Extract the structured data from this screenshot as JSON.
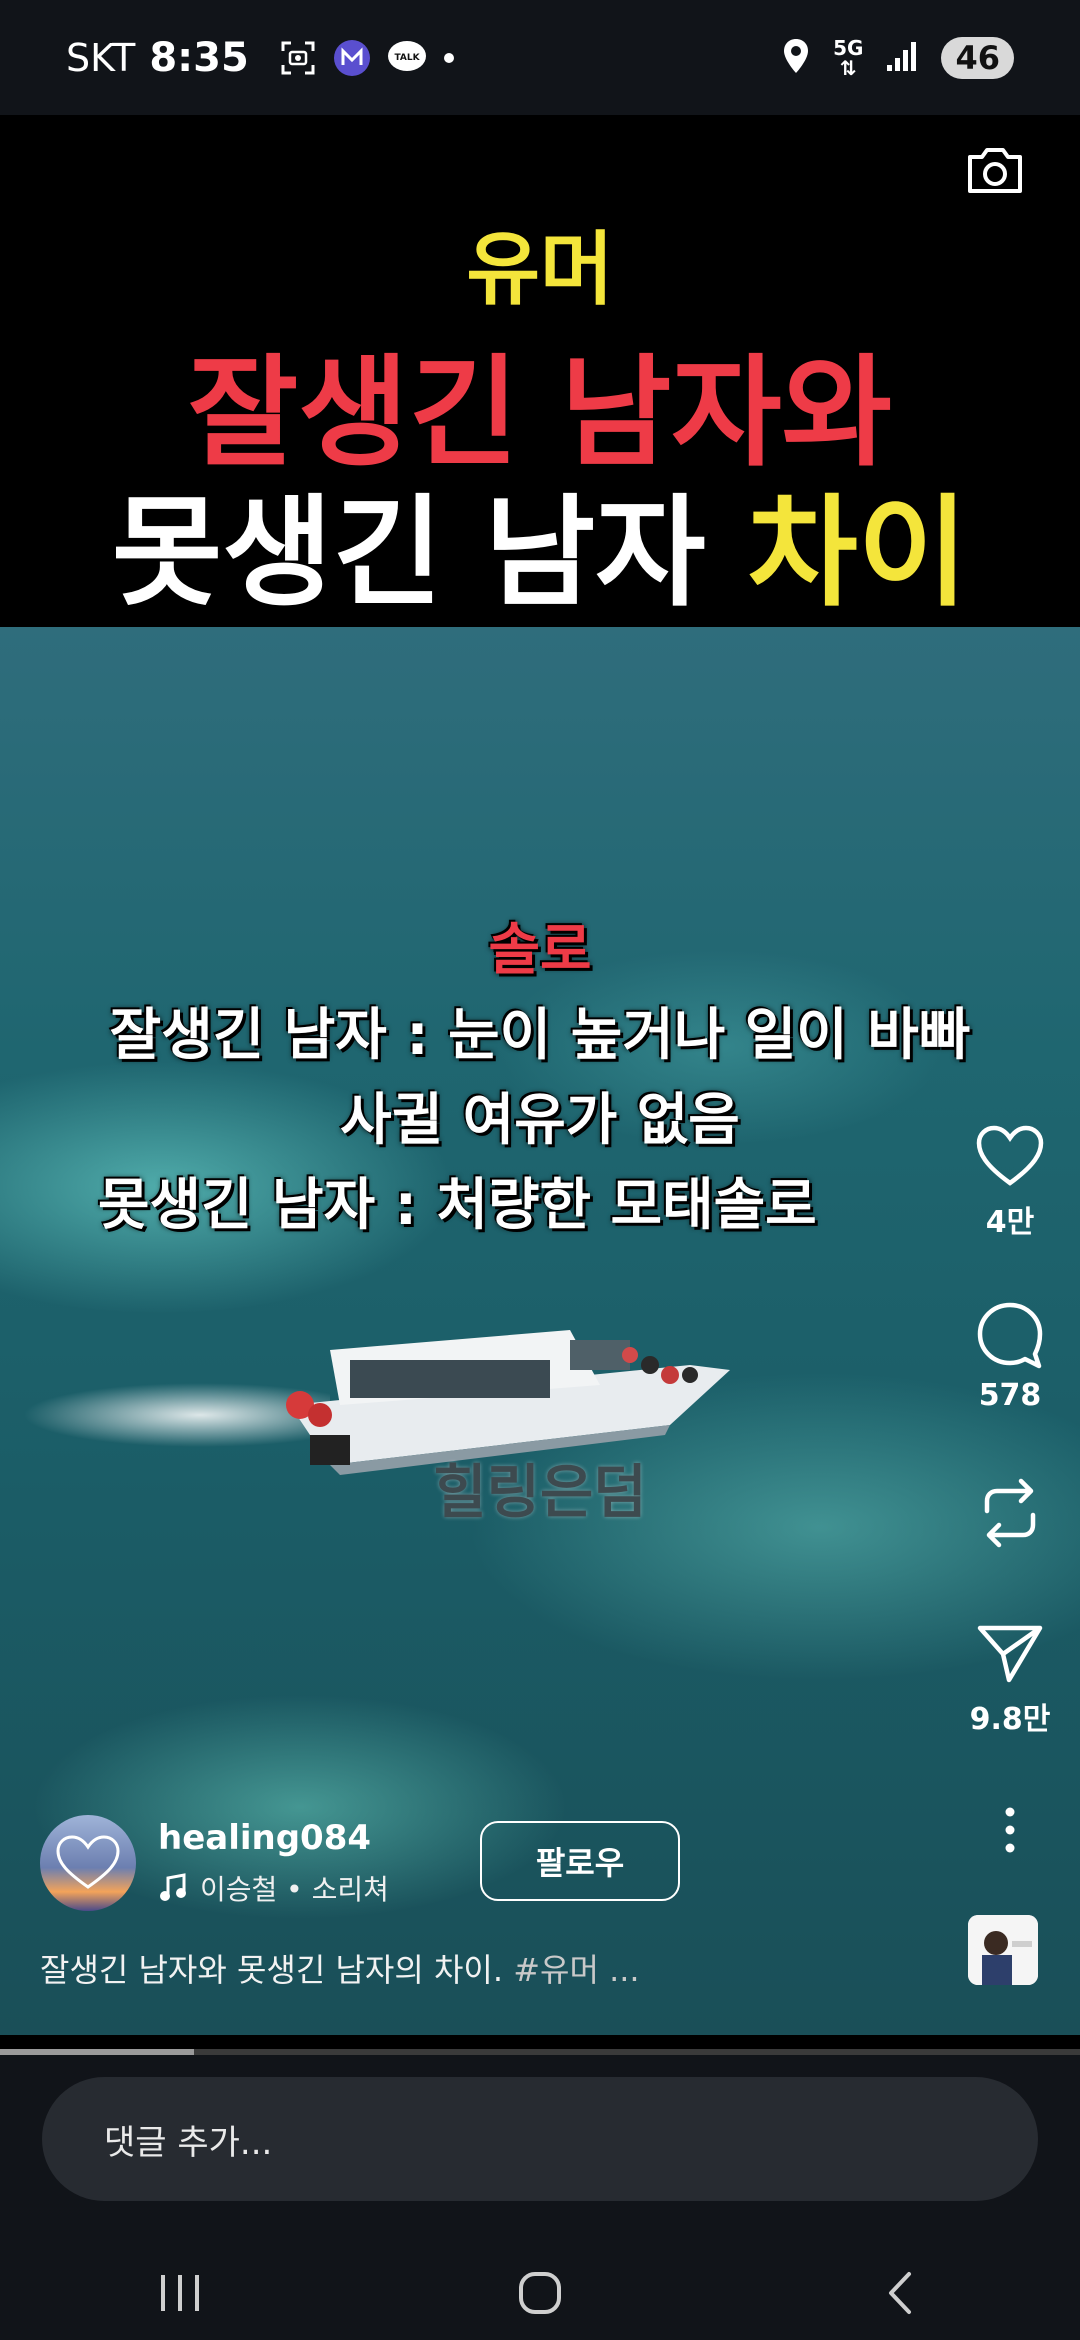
{
  "status_bar": {
    "carrier": "SKT",
    "time": "8:35",
    "network": "5G",
    "battery": "46"
  },
  "video": {
    "title_line1": "유머",
    "title_line2": "잘생긴 남자와",
    "title_line3_main": "못생긴 남자",
    "title_line3_accent": "차이",
    "overlay_heading": "솔로",
    "overlay_line1": "잘생긴 남자 : 눈이 높거나 일이 바빠",
    "overlay_line2": "사귈 여유가 없음",
    "overlay_line3": "못생긴 남자 : 처량한 모태솔로",
    "watermark": "힐링은덤"
  },
  "actions": {
    "likes": "4만",
    "comments": "578",
    "shares": "9.8만"
  },
  "post": {
    "username": "healing084",
    "music": "이승철 • 소리쳐",
    "follow_label": "팔로우",
    "caption_text": "잘생긴 남자와 못생긴 남자의 차이.",
    "caption_tag": "#유머 ..."
  },
  "progress": 0.18,
  "comment_placeholder": "댓글 추가...",
  "colors": {
    "title_yellow": "#f4e53b",
    "title_red": "#ee3b47",
    "bar_bg": "#111419",
    "input_bg": "#272b31"
  }
}
